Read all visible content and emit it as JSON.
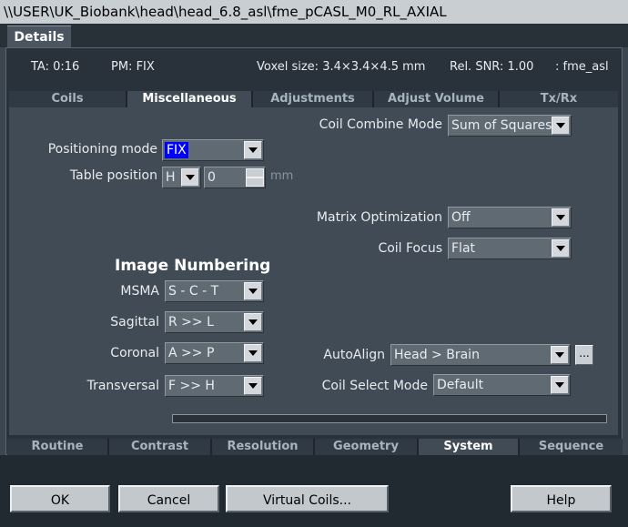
{
  "window": {
    "title": "\\\\USER\\UK_Biobank\\head\\head_6.8_asl\\fme_pCASL_M0_RL_AXIAL"
  },
  "details_tab": "Details",
  "info": {
    "ta": "TA: 0:16",
    "pm": "PM: FIX",
    "voxel": "Voxel size: 3.4×3.4×4.5 mm",
    "snr": "Rel. SNR: 1.00",
    "seq": ": fme_asl"
  },
  "top_tabs": [
    "Coils",
    "Miscellaneous",
    "Adjustments",
    "Adjust Volume",
    "Tx/Rx"
  ],
  "active_top_tab": "Miscellaneous",
  "fields": {
    "coil_combine": {
      "label": "Coil Combine Mode",
      "value": "Sum of Squares"
    },
    "positioning": {
      "label": "Positioning mode",
      "value": "FIX"
    },
    "table_position": {
      "label": "Table position",
      "dir": "H",
      "value": "0",
      "unit": "mm"
    },
    "matrix_opt": {
      "label": "Matrix Optimization",
      "value": "Off"
    },
    "coil_focus": {
      "label": "Coil Focus",
      "value": "Flat"
    },
    "image_numbering": {
      "heading": "Image Numbering"
    },
    "msma": {
      "label": "MSMA",
      "value": "S - C - T"
    },
    "sagittal": {
      "label": "Sagittal",
      "value": "R >> L"
    },
    "coronal": {
      "label": "Coronal",
      "value": "A >> P"
    },
    "transversal": {
      "label": "Transversal",
      "value": "F >> H"
    },
    "autoalign": {
      "label": "AutoAlign",
      "value": "Head > Brain",
      "more": "..."
    },
    "coil_select": {
      "label": "Coil Select Mode",
      "value": "Default"
    }
  },
  "bottom_tabs": [
    "Routine",
    "Contrast",
    "Resolution",
    "Geometry",
    "System",
    "Sequence"
  ],
  "active_bottom_tab": "System",
  "buttons": {
    "ok": "OK",
    "cancel": "Cancel",
    "virtual_coils": "Virtual Coils...",
    "help": "Help"
  },
  "colors": {
    "selection": "#0000ff",
    "panel": "#414b55",
    "background": "#3c4650"
  }
}
